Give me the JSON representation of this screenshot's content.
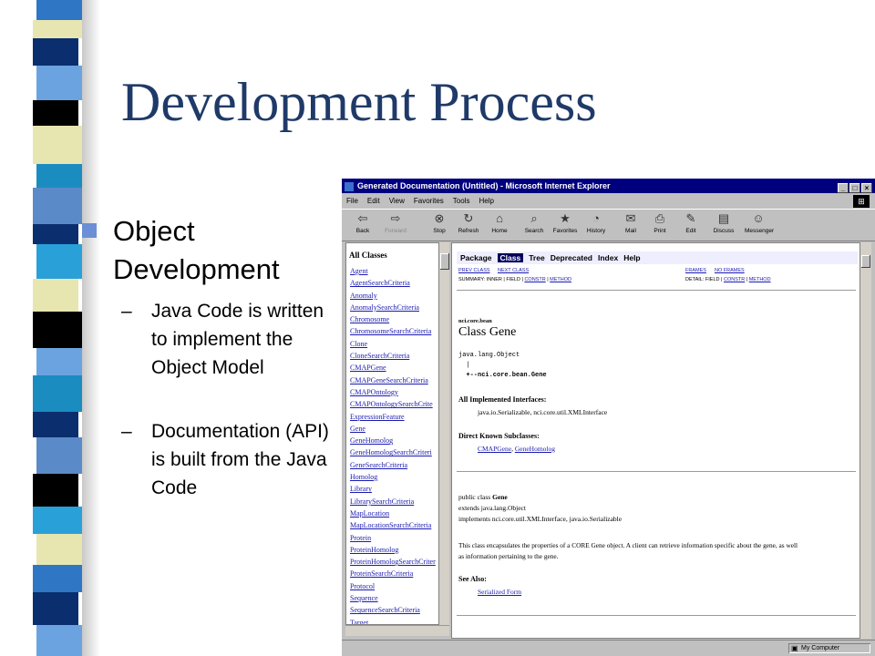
{
  "slide": {
    "title": "Development Process",
    "bullet": "Object Development",
    "subbullets": [
      {
        "dash": "–",
        "text": "Java Code is written to implement the Object Model"
      },
      {
        "dash": "–",
        "text": "Documentation (API) is built from the Java Code"
      }
    ]
  },
  "browser": {
    "window_title": "Generated Documentation (Untitled) - Microsoft Internet Explorer",
    "window_buttons": {
      "minimize": "_",
      "maximize": "□",
      "close": "×"
    },
    "menu": [
      "File",
      "Edit",
      "View",
      "Favorites",
      "Tools",
      "Help"
    ],
    "toolbar": [
      {
        "label": "Back",
        "icon": "back-arrow-icon",
        "glyph": "⇦"
      },
      {
        "label": "Forward",
        "icon": "forward-arrow-icon",
        "glyph": "⇨"
      },
      {
        "label": "Stop",
        "icon": "stop-icon",
        "glyph": "⊗"
      },
      {
        "label": "Refresh",
        "icon": "refresh-icon",
        "glyph": "↻"
      },
      {
        "label": "Home",
        "icon": "home-icon",
        "glyph": "⌂"
      },
      {
        "label": "Search",
        "icon": "search-icon",
        "glyph": "⌕"
      },
      {
        "label": "Favorites",
        "icon": "favorites-icon",
        "glyph": "★"
      },
      {
        "label": "History",
        "icon": "history-icon",
        "glyph": "◔"
      },
      {
        "label": "Mail",
        "icon": "mail-icon",
        "glyph": "✉"
      },
      {
        "label": "Print",
        "icon": "print-icon",
        "glyph": "⎙"
      },
      {
        "label": "Edit",
        "icon": "edit-icon",
        "glyph": "✎"
      },
      {
        "label": "Discuss",
        "icon": "discuss-icon",
        "glyph": "▤"
      },
      {
        "label": "Messenger",
        "icon": "messenger-icon",
        "glyph": "☺"
      }
    ],
    "left_frame": {
      "heading": "All Classes",
      "classes": [
        "Agent",
        "AgentSearchCriteria",
        "Anomaly",
        "AnomalySearchCriteria",
        "Chromosome",
        "ChromosomeSearchCriteria",
        "Clone",
        "CloneSearchCriteria",
        "CMAPGene",
        "CMAPGeneSearchCriteria",
        "CMAPOntology",
        "CMAPOntologySearchCrite",
        "ExpressionFeature",
        "Gene",
        "GeneHomolog",
        "GeneHomologSearchCriteri",
        "GeneSearchCriteria",
        "Homolog",
        "Library",
        "LibrarySearchCriteria",
        "MapLocation",
        "MapLocationSearchCriteria",
        "Protein",
        "ProteinHomolog",
        "ProteinHomologSearchCriter",
        "ProteinSearchCriteria",
        "Protocol",
        "Sequence",
        "SequenceSearchCriteria",
        "Target"
      ]
    },
    "doc": {
      "nav": [
        "Package",
        "Class",
        "Tree",
        "Deprecated",
        "Index",
        "Help"
      ],
      "prev_class": "PREV CLASS",
      "next_class": "NEXT CLASS",
      "frames": "FRAMES",
      "no_frames": "NO FRAMES",
      "summary_prefix": "SUMMARY:  INNER | FIELD | ",
      "summary_constr": "CONSTR",
      "summary_sep": " | ",
      "summary_method": "METHOD",
      "detail_prefix": "DETAIL:  FIELD | ",
      "detail_constr": "CONSTR",
      "detail_sep": " | ",
      "detail_method": "METHOD",
      "package": "nci.core.bean",
      "class_title": "Class Gene",
      "hierarchy": [
        "java.lang.Object",
        "  |",
        "  +--nci.core.bean.Gene"
      ],
      "interfaces_heading": "All Implemented Interfaces:",
      "interfaces": "java.io.Serializable, nci.core.util.XMLInterface",
      "subclasses_heading": "Direct Known Subclasses:",
      "subclass_1": "CMAPGene",
      "subclass_sep": ", ",
      "subclass_2": "GeneHomolog",
      "decl_prefix": "public class ",
      "decl_name": "Gene",
      "decl_extends": "extends java.lang.Object",
      "decl_implements": "implements nci.core.util.XMLInterface, java.io.Serializable",
      "description_1": "This class encapsulates the properties of a CORE Gene object. A client can retrieve information specific about the gene, as well",
      "description_2": "as information pertaining to the gene.",
      "see_also_heading": "See Also:",
      "see_also_link": "Serialized Form"
    },
    "status": {
      "zone": "My Computer",
      "zone_icon": "computer-icon"
    }
  },
  "colors": {
    "title": "#1f3a68",
    "titlebar": "#00007e",
    "link": "#1a1ab0",
    "strip_palette": [
      "#0a2e6e",
      "#2f77c4",
      "#e8e6b0",
      "#1b8cc0",
      "#000000",
      "#6aa3e0",
      "#5b8ac8",
      "#2aa0d8"
    ]
  }
}
